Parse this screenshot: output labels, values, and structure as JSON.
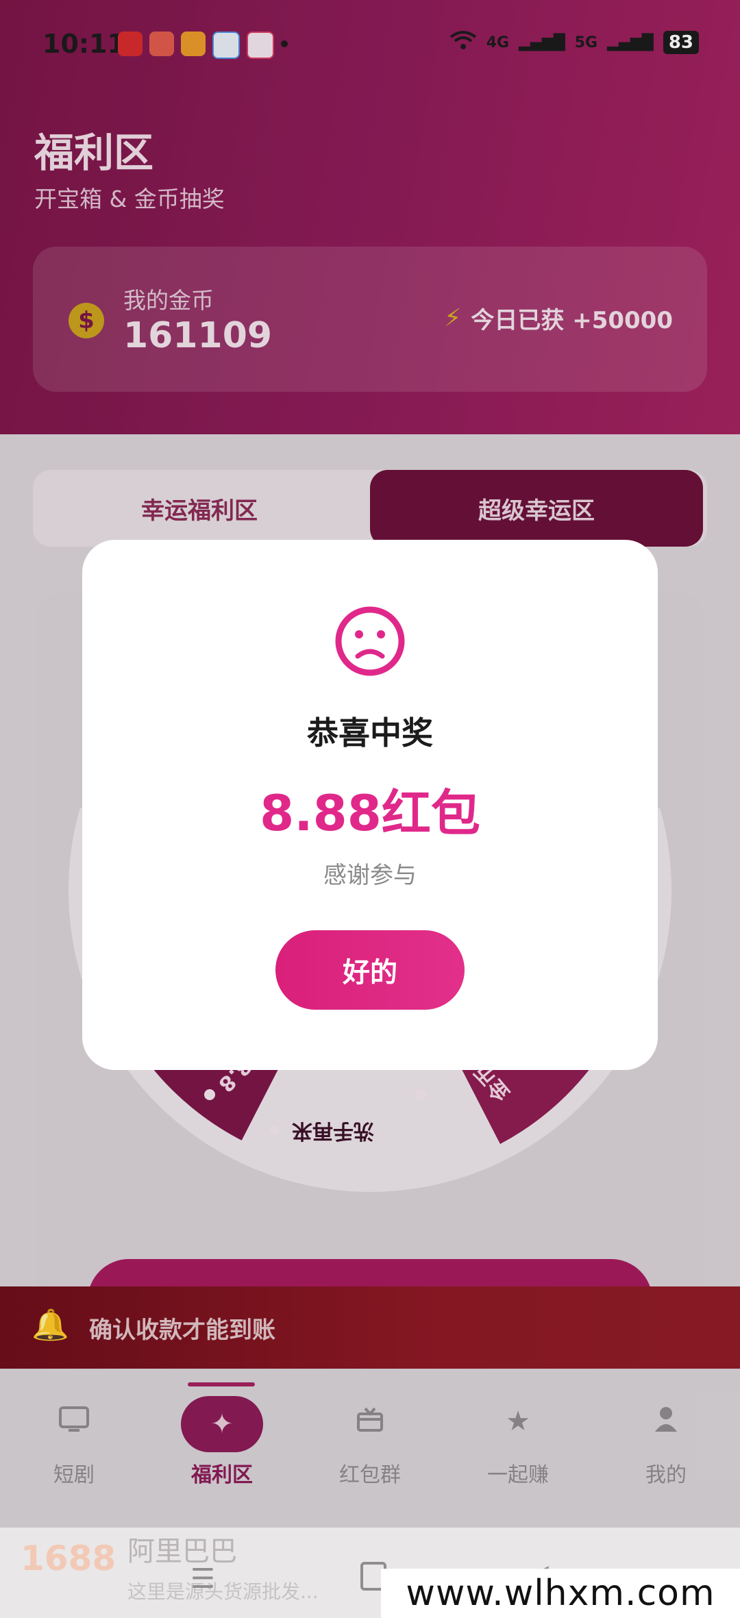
{
  "status_bar": {
    "time": "10:11",
    "network_4g": "4G",
    "network_5g": "5G",
    "battery": "83"
  },
  "header": {
    "title": "福利区",
    "subtitle": "开宝箱 & 金币抽奖"
  },
  "coins": {
    "label": "我的金币",
    "value": "161109",
    "coin_symbol": "$",
    "today_label": "今日已获 +50000"
  },
  "tabs": [
    {
      "label": "幸运福利区",
      "active": false
    },
    {
      "label": "超级幸运区",
      "active": true
    }
  ],
  "wheel": {
    "segment_bottom": "洗手再来",
    "segment_left": "8.8",
    "segment_right": "金币"
  },
  "notice": {
    "text": "确认收款才能到账"
  },
  "bottom_nav": [
    {
      "icon": "tv-icon",
      "label": "短剧"
    },
    {
      "icon": "sparkle-icon",
      "label": "福利区"
    },
    {
      "icon": "gift-box-icon",
      "label": "红包群"
    },
    {
      "icon": "star-icon",
      "label": "一起赚"
    },
    {
      "icon": "person-icon",
      "label": "我的"
    }
  ],
  "ad": {
    "logo": "1688",
    "title": "阿里巴巴",
    "subtitle": "这里是源头货源批发..."
  },
  "watermark": "www.wlhxm.com",
  "modal": {
    "title": "恭喜中奖",
    "prize": "8.88红包",
    "message": "感谢参与",
    "ok_button": "好的"
  },
  "colors": {
    "brand": "#8a1a55",
    "accent": "#e0288a"
  }
}
